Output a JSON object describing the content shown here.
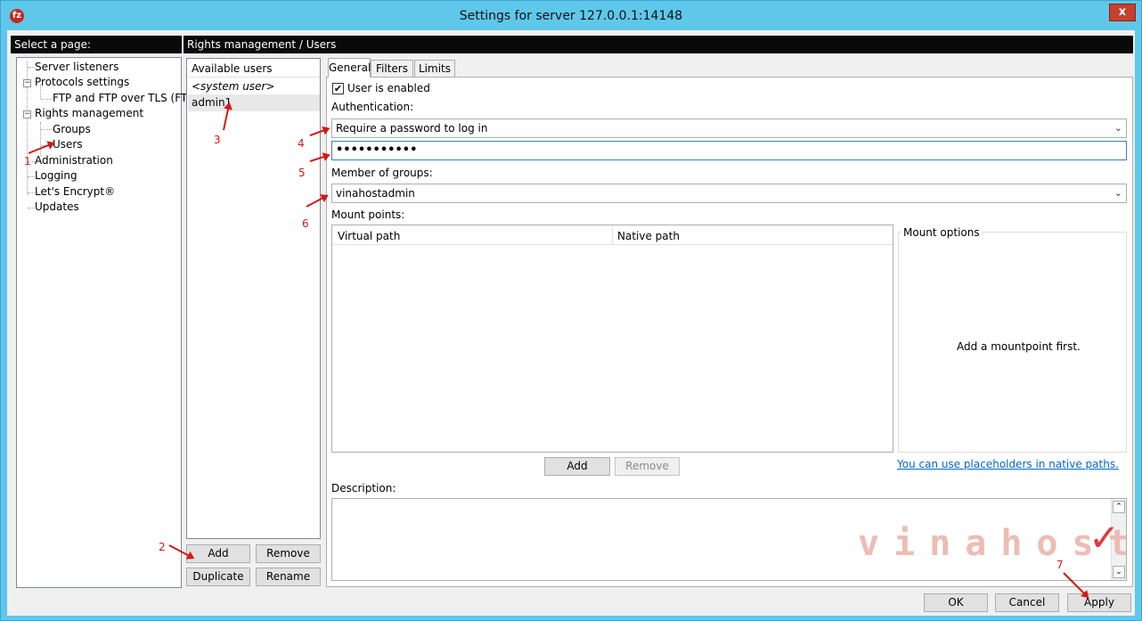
{
  "window": {
    "title": "Settings for server 127.0.0.1:14148",
    "close_label": "x",
    "icon_label": "fz"
  },
  "left": {
    "header": "Select a page:",
    "tree": [
      {
        "label": "Server listeners"
      },
      {
        "label": "Protocols settings"
      },
      {
        "label": "FTP and FTP over TLS (FTPS)"
      },
      {
        "label": "Rights management"
      },
      {
        "label": "Groups"
      },
      {
        "label": "Users"
      },
      {
        "label": "Administration"
      },
      {
        "label": "Logging"
      },
      {
        "label": "Let's Encrypt®"
      },
      {
        "label": "Updates"
      }
    ]
  },
  "breadcrumb": "Rights management / Users",
  "users": {
    "header": "Available users",
    "items": [
      {
        "label": "<system user>"
      },
      {
        "label": "admin1"
      }
    ],
    "add_label": "Add",
    "remove_label": "Remove",
    "duplicate_label": "Duplicate",
    "rename_label": "Rename"
  },
  "tabs": [
    {
      "label": "General"
    },
    {
      "label": "Filters"
    },
    {
      "label": "Limits"
    }
  ],
  "general": {
    "user_enabled_label": "User is enabled",
    "authentication_label": "Authentication:",
    "authentication_value": "Require a password to log in",
    "password_value": "•••••••••••",
    "member_of_groups_label": "Member of groups:",
    "group_value": "vinahostadmin",
    "mount_points_label": "Mount points:",
    "col_virtual_path": "Virtual path",
    "col_native_path": "Native path",
    "mount_options_label": "Mount options",
    "mount_options_empty": "Add a mountpoint first.",
    "add_label": "Add",
    "remove_label": "Remove",
    "placeholder_link": "You can use placeholders in native paths.",
    "description_label": "Description:"
  },
  "footer": {
    "ok_label": "OK",
    "cancel_label": "Cancel",
    "apply_label": "Apply"
  },
  "annotations": [
    "1",
    "2",
    "3",
    "4",
    "5",
    "6",
    "7"
  ],
  "watermark": "vinahost"
}
